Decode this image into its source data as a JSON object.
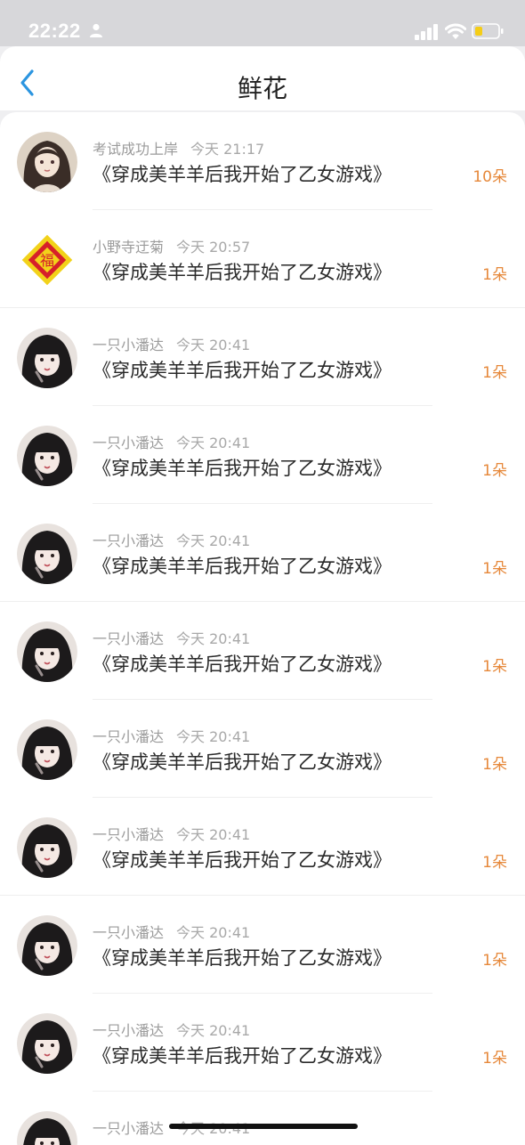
{
  "status_bar": {
    "time": "22:22"
  },
  "header": {
    "title": "鲜花"
  },
  "list": [
    {
      "user": "考试成功上岸",
      "time": "今天 21:17",
      "book": "《穿成美羊羊后我开始了乙女游戏》",
      "count": "10朵",
      "avatar": "avatar-long-hair-girl",
      "divider": "inset"
    },
    {
      "user": "小野寺迂菊",
      "time": "今天 20:57",
      "book": "《穿成美羊羊后我开始了乙女游戏》",
      "count": "1朵",
      "avatar": "avatar-fu-charm",
      "divider": "full"
    },
    {
      "user": "一只小潘达",
      "time": "今天 20:41",
      "book": "《穿成美羊羊后我开始了乙女游戏》",
      "count": "1朵",
      "avatar": "avatar-bangs-girl",
      "divider": "inset"
    },
    {
      "user": "一只小潘达",
      "time": "今天 20:41",
      "book": "《穿成美羊羊后我开始了乙女游戏》",
      "count": "1朵",
      "avatar": "avatar-bangs-girl",
      "divider": "inset"
    },
    {
      "user": "一只小潘达",
      "time": "今天 20:41",
      "book": "《穿成美羊羊后我开始了乙女游戏》",
      "count": "1朵",
      "avatar": "avatar-bangs-girl",
      "divider": "full"
    },
    {
      "user": "一只小潘达",
      "time": "今天 20:41",
      "book": "《穿成美羊羊后我开始了乙女游戏》",
      "count": "1朵",
      "avatar": "avatar-bangs-girl",
      "divider": "inset"
    },
    {
      "user": "一只小潘达",
      "time": "今天 20:41",
      "book": "《穿成美羊羊后我开始了乙女游戏》",
      "count": "1朵",
      "avatar": "avatar-bangs-girl",
      "divider": "inset"
    },
    {
      "user": "一只小潘达",
      "time": "今天 20:41",
      "book": "《穿成美羊羊后我开始了乙女游戏》",
      "count": "1朵",
      "avatar": "avatar-bangs-girl",
      "divider": "full"
    },
    {
      "user": "一只小潘达",
      "time": "今天 20:41",
      "book": "《穿成美羊羊后我开始了乙女游戏》",
      "count": "1朵",
      "avatar": "avatar-bangs-girl",
      "divider": "inset"
    },
    {
      "user": "一只小潘达",
      "time": "今天 20:41",
      "book": "《穿成美羊羊后我开始了乙女游戏》",
      "count": "1朵",
      "avatar": "avatar-bangs-girl",
      "divider": "inset"
    },
    {
      "user": "一只小潘达",
      "time": "今天 20:41",
      "book": "",
      "count": "",
      "avatar": "avatar-bangs-girl",
      "divider": "none"
    }
  ],
  "icons": {
    "back": "chevron-left-icon",
    "person": "person-icon",
    "signal": "cellular-signal-icon",
    "wifi": "wifi-icon",
    "battery": "battery-icon"
  },
  "colors": {
    "accent_back": "#2b95e0",
    "count_text": "#e6883a",
    "battery_fill": "#f5cd16"
  }
}
